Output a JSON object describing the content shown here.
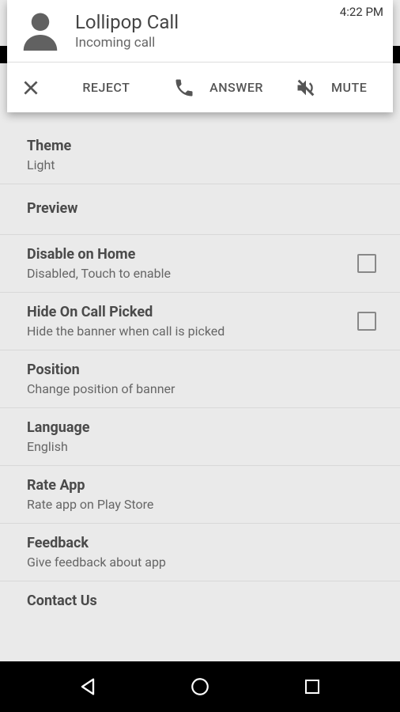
{
  "banner": {
    "title": "Lollipop Call",
    "subtitle": "Incoming call",
    "time": "4:22 PM",
    "reject": "REJECT",
    "answer": "ANSWER",
    "mute": "MUTE"
  },
  "settings": [
    {
      "title": "Theme",
      "sub": "Light",
      "checkbox": false
    },
    {
      "title": "Preview",
      "sub": "",
      "checkbox": false
    },
    {
      "title": "Disable on Home",
      "sub": "Disabled, Touch to enable",
      "checkbox": true
    },
    {
      "title": "Hide On Call Picked",
      "sub": "Hide the banner when call is picked",
      "checkbox": true
    },
    {
      "title": "Position",
      "sub": "Change position of banner",
      "checkbox": false
    },
    {
      "title": "Language",
      "sub": "English",
      "checkbox": false
    },
    {
      "title": "Rate App",
      "sub": "Rate app on Play Store",
      "checkbox": false
    },
    {
      "title": "Feedback",
      "sub": "Give feedback about app",
      "checkbox": false
    },
    {
      "title": "Contact Us",
      "sub": "",
      "checkbox": false
    }
  ]
}
